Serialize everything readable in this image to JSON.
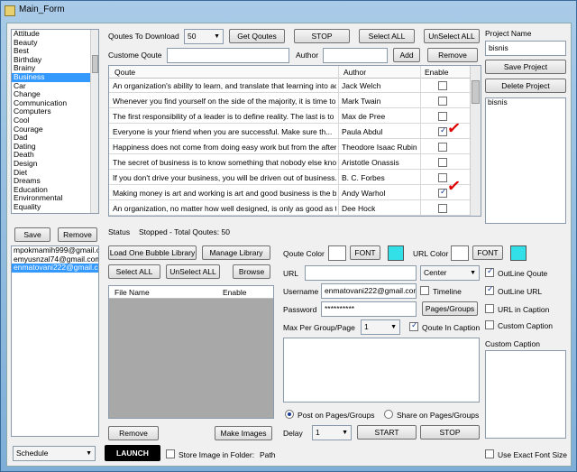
{
  "window": {
    "title": "Main_Form"
  },
  "categories": {
    "items": [
      "Attitude",
      "Beauty",
      "Best",
      "Birthday",
      "Brainy",
      "Business",
      "Car",
      "Change",
      "Communication",
      "Computers",
      "Cool",
      "Courage",
      "Dad",
      "Dating",
      "Death",
      "Design",
      "Diet",
      "Dreams",
      "Education",
      "Environmental",
      "Equality"
    ],
    "selected_index": 5
  },
  "accounts": {
    "save_label": "Save",
    "remove_label": "Remove",
    "items": [
      "mpokmamih999@gmail.c",
      "emyusnzal74@gmail.com",
      "enmatovani222@gmail.co"
    ],
    "selected_index": 2
  },
  "toolbar": {
    "qoutes_to_download_label": "Qoutes To Download",
    "qoutes_count": "50",
    "get_qoutes_label": "Get Qoutes",
    "stop_label": "STOP",
    "select_all_label": "Select ALL",
    "unselect_all_label": "UnSelect ALL",
    "custome_qoute_label": "Custome Qoute",
    "author_label": "Author",
    "add_label": "Add",
    "remove_label": "Remove"
  },
  "quotes_table": {
    "headers": {
      "quote": "Qoute",
      "author": "Author",
      "enable": "Enable"
    },
    "rows": [
      {
        "quote": "An organization's ability to learn, and translate that learning into actio...",
        "author": "Jack Welch",
        "enabled": false
      },
      {
        "quote": "Whenever you find yourself on the side of the majority, it is time to pa...",
        "author": "Mark Twain",
        "enabled": false
      },
      {
        "quote": "The first responsibility of a leader is to define reality. The last is to say ...",
        "author": "Max de Pree",
        "enabled": false
      },
      {
        "quote": "Everyone is your friend when you are successful. Make sure th...",
        "author": "Paula Abdul",
        "enabled": true
      },
      {
        "quote": "Happiness does not come from doing easy work but from the afterglo...",
        "author": "Theodore Isaac Rubin",
        "enabled": false
      },
      {
        "quote": "The secret of business is to know something that nobody else knows.",
        "author": "Aristotle Onassis",
        "enabled": false
      },
      {
        "quote": "If you don't drive your business, you will be driven out of business.",
        "author": "B. C. Forbes",
        "enabled": false
      },
      {
        "quote": "Making money is art and working is art and good business is the best...",
        "author": "Andy Warhol",
        "enabled": true
      },
      {
        "quote": "An organization, no matter how well designed, is only as good as the...",
        "author": "Dee Hock",
        "enabled": false
      }
    ]
  },
  "project": {
    "name_label": "Project Name",
    "name_value": "bisnis",
    "save_label": "Save Project",
    "delete_label": "Delete Project",
    "list": [
      "bisnis"
    ]
  },
  "status": {
    "label": "Status",
    "text": "Stopped - Total Qoutes: 50"
  },
  "library": {
    "load_label": "Load One Bubble Library",
    "manage_label": "Manage Library",
    "select_all_label": "Select ALL",
    "unselect_all_label": "UnSelect ALL",
    "browse_label": "Browse",
    "headers": {
      "file_name": "File Name",
      "enable": "Enable"
    },
    "remove_label": "Remove",
    "make_images_label": "Make Images"
  },
  "style": {
    "qoute_color_label": "Qoute Color",
    "font_label": "FONT",
    "url_color_label": "URL Color",
    "qoute_color": "#ffffff",
    "qoute_accent": "#33e0e8",
    "url_color": "#ffffff",
    "url_accent": "#33e0e8",
    "outline_qoute_label": "OutLine Qoute",
    "outline_url_label": "OutLine URL",
    "url_in_caption_label": "URL in Caption",
    "custom_caption_check_label": "Custom Caption",
    "custom_caption_label": "Custom Caption",
    "outline_qoute": true,
    "outline_url": true,
    "url_in_caption": false,
    "custom_caption_checked": false
  },
  "posting": {
    "url_label": "URL",
    "url_value": "",
    "align_value": "Center",
    "username_label": "Username",
    "username_value": "enmatovani222@gmail.com",
    "timeline_label": "Timeline",
    "timeline": false,
    "password_label": "Password",
    "password_value": "**********",
    "pages_groups_label": "Pages/Groups",
    "max_per_group_label": "Max Per Group/Page",
    "max_per_group_value": "1",
    "qoute_in_caption_label": "Qoute In Caption",
    "qoute_in_caption": true,
    "post_on_pages_label": "Post on Pages/Groups",
    "share_on_pages_label": "Share on Pages/Groups",
    "delay_label": "Delay",
    "delay_value": "1",
    "start_label": "START",
    "stop_label": "STOP"
  },
  "footer": {
    "schedule_value": "Schedule",
    "launch_label": "LAUNCH",
    "store_image_label": "Store Image in Folder:",
    "path_label": "Path",
    "exact_font_label": "Use Exact Font Size",
    "store_image": false,
    "exact_font": false
  }
}
